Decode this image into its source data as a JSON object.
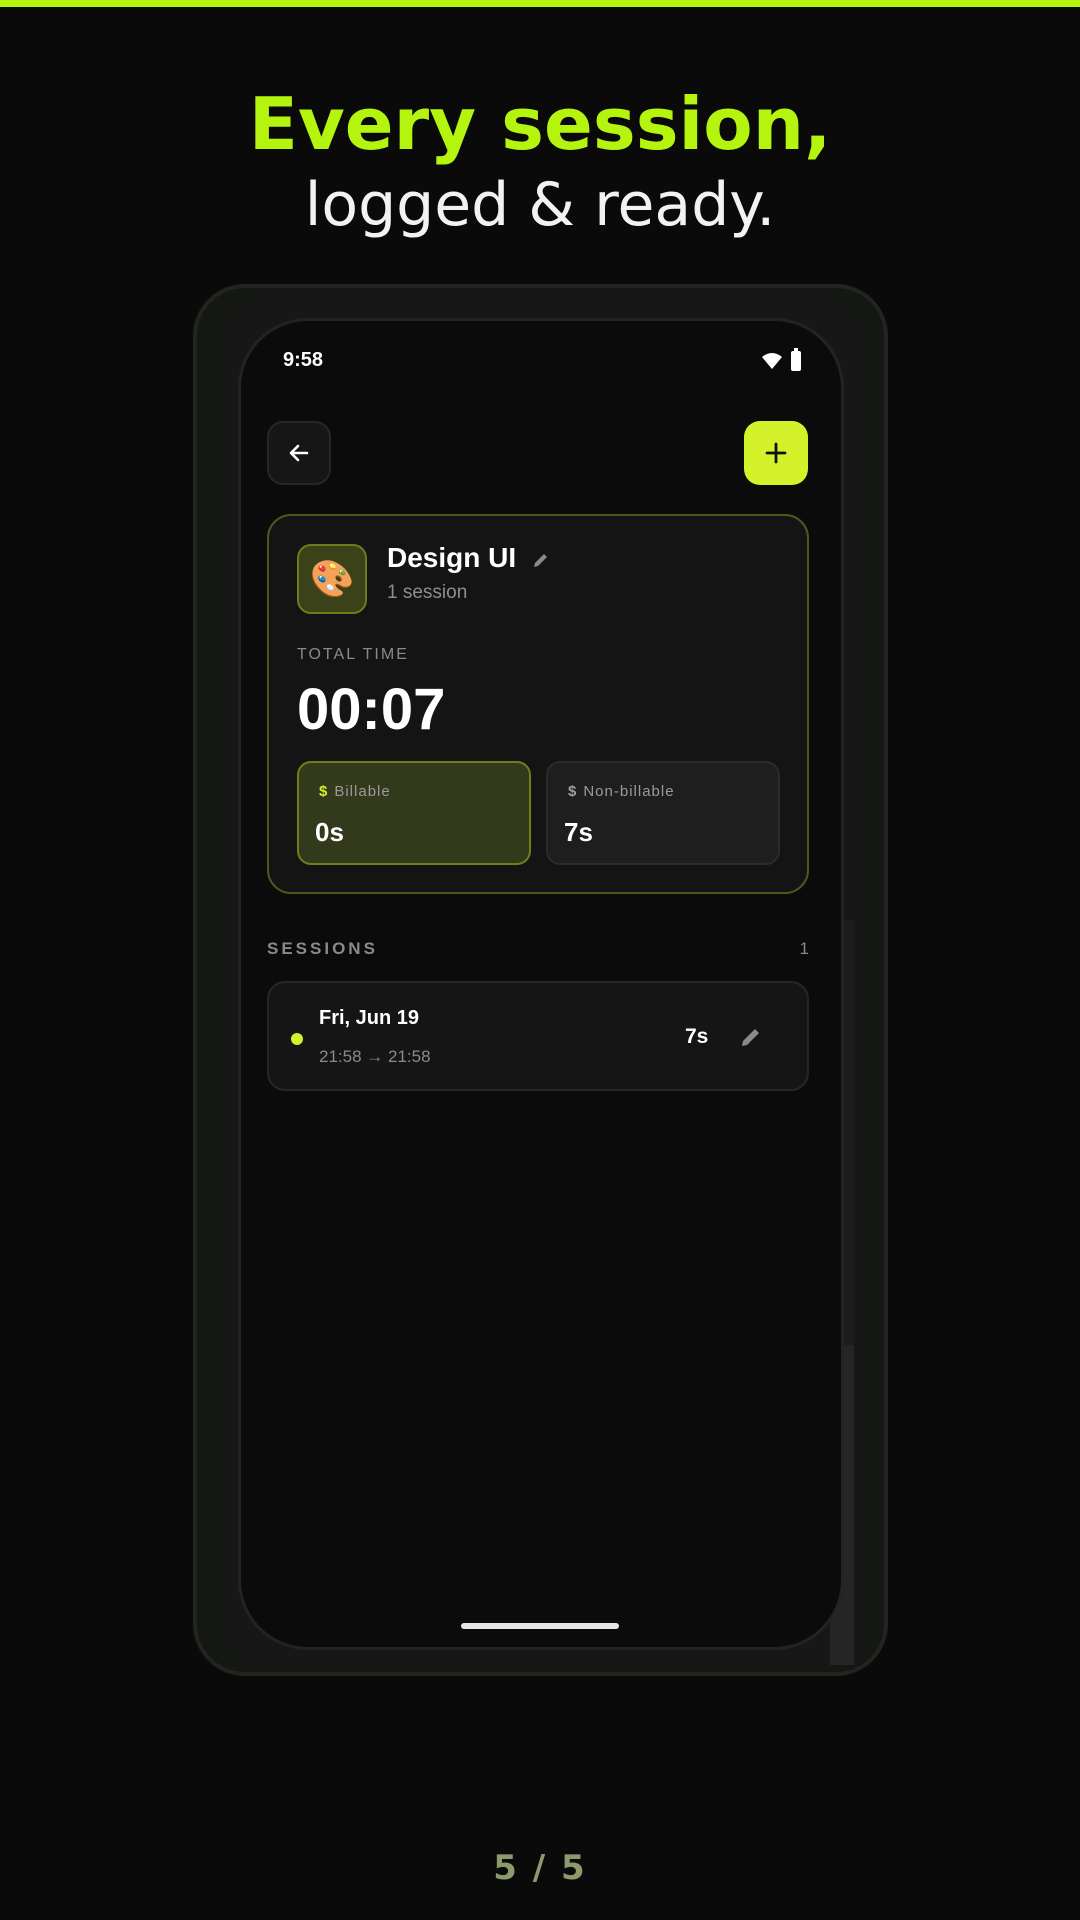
{
  "headline": {
    "line1": "Every session,",
    "line2": "logged & ready."
  },
  "status_bar": {
    "time": "9:58",
    "icons": [
      "wifi-icon",
      "battery-icon"
    ]
  },
  "toolbar": {
    "back_icon": "arrow-left-icon",
    "add_icon": "plus-icon"
  },
  "project": {
    "icon": "palette-emoji",
    "emoji": "🎨",
    "name": "Design UI",
    "session_count": "1 session",
    "total_label": "TOTAL TIME",
    "total_value": "00:07",
    "billable": {
      "symbol": "$",
      "label": "Billable",
      "value": "0s"
    },
    "non_billable": {
      "symbol": "$",
      "label": "Non-billable",
      "value": "7s"
    }
  },
  "sessions": {
    "header": "SESSIONS",
    "count": "1",
    "items": [
      {
        "date": "Fri, Jun 19",
        "times": "21:58 → 21:58",
        "duration": "7s"
      }
    ]
  },
  "pager": {
    "label": "5 / 5"
  },
  "colors": {
    "accent": "#b5f40f",
    "button_accent": "#d4f22b",
    "background": "#0a0a0a"
  }
}
